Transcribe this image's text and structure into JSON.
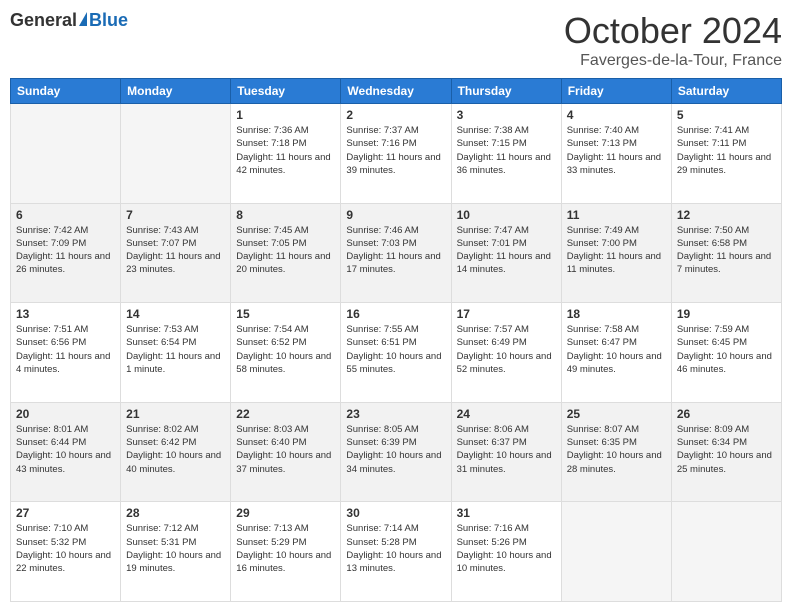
{
  "header": {
    "logo_general": "General",
    "logo_blue": "Blue",
    "month_title": "October 2024",
    "location": "Faverges-de-la-Tour, France"
  },
  "weekdays": [
    "Sunday",
    "Monday",
    "Tuesday",
    "Wednesday",
    "Thursday",
    "Friday",
    "Saturday"
  ],
  "weeks": [
    [
      {
        "day": "",
        "empty": true
      },
      {
        "day": "",
        "empty": true
      },
      {
        "day": "1",
        "sunrise": "7:36 AM",
        "sunset": "7:18 PM",
        "daylight": "11 hours and 42 minutes."
      },
      {
        "day": "2",
        "sunrise": "7:37 AM",
        "sunset": "7:16 PM",
        "daylight": "11 hours and 39 minutes."
      },
      {
        "day": "3",
        "sunrise": "7:38 AM",
        "sunset": "7:15 PM",
        "daylight": "11 hours and 36 minutes."
      },
      {
        "day": "4",
        "sunrise": "7:40 AM",
        "sunset": "7:13 PM",
        "daylight": "11 hours and 33 minutes."
      },
      {
        "day": "5",
        "sunrise": "7:41 AM",
        "sunset": "7:11 PM",
        "daylight": "11 hours and 29 minutes."
      }
    ],
    [
      {
        "day": "6",
        "sunrise": "7:42 AM",
        "sunset": "7:09 PM",
        "daylight": "11 hours and 26 minutes."
      },
      {
        "day": "7",
        "sunrise": "7:43 AM",
        "sunset": "7:07 PM",
        "daylight": "11 hours and 23 minutes."
      },
      {
        "day": "8",
        "sunrise": "7:45 AM",
        "sunset": "7:05 PM",
        "daylight": "11 hours and 20 minutes."
      },
      {
        "day": "9",
        "sunrise": "7:46 AM",
        "sunset": "7:03 PM",
        "daylight": "11 hours and 17 minutes."
      },
      {
        "day": "10",
        "sunrise": "7:47 AM",
        "sunset": "7:01 PM",
        "daylight": "11 hours and 14 minutes."
      },
      {
        "day": "11",
        "sunrise": "7:49 AM",
        "sunset": "7:00 PM",
        "daylight": "11 hours and 11 minutes."
      },
      {
        "day": "12",
        "sunrise": "7:50 AM",
        "sunset": "6:58 PM",
        "daylight": "11 hours and 7 minutes."
      }
    ],
    [
      {
        "day": "13",
        "sunrise": "7:51 AM",
        "sunset": "6:56 PM",
        "daylight": "11 hours and 4 minutes."
      },
      {
        "day": "14",
        "sunrise": "7:53 AM",
        "sunset": "6:54 PM",
        "daylight": "11 hours and 1 minute."
      },
      {
        "day": "15",
        "sunrise": "7:54 AM",
        "sunset": "6:52 PM",
        "daylight": "10 hours and 58 minutes."
      },
      {
        "day": "16",
        "sunrise": "7:55 AM",
        "sunset": "6:51 PM",
        "daylight": "10 hours and 55 minutes."
      },
      {
        "day": "17",
        "sunrise": "7:57 AM",
        "sunset": "6:49 PM",
        "daylight": "10 hours and 52 minutes."
      },
      {
        "day": "18",
        "sunrise": "7:58 AM",
        "sunset": "6:47 PM",
        "daylight": "10 hours and 49 minutes."
      },
      {
        "day": "19",
        "sunrise": "7:59 AM",
        "sunset": "6:45 PM",
        "daylight": "10 hours and 46 minutes."
      }
    ],
    [
      {
        "day": "20",
        "sunrise": "8:01 AM",
        "sunset": "6:44 PM",
        "daylight": "10 hours and 43 minutes."
      },
      {
        "day": "21",
        "sunrise": "8:02 AM",
        "sunset": "6:42 PM",
        "daylight": "10 hours and 40 minutes."
      },
      {
        "day": "22",
        "sunrise": "8:03 AM",
        "sunset": "6:40 PM",
        "daylight": "10 hours and 37 minutes."
      },
      {
        "day": "23",
        "sunrise": "8:05 AM",
        "sunset": "6:39 PM",
        "daylight": "10 hours and 34 minutes."
      },
      {
        "day": "24",
        "sunrise": "8:06 AM",
        "sunset": "6:37 PM",
        "daylight": "10 hours and 31 minutes."
      },
      {
        "day": "25",
        "sunrise": "8:07 AM",
        "sunset": "6:35 PM",
        "daylight": "10 hours and 28 minutes."
      },
      {
        "day": "26",
        "sunrise": "8:09 AM",
        "sunset": "6:34 PM",
        "daylight": "10 hours and 25 minutes."
      }
    ],
    [
      {
        "day": "27",
        "sunrise": "7:10 AM",
        "sunset": "5:32 PM",
        "daylight": "10 hours and 22 minutes."
      },
      {
        "day": "28",
        "sunrise": "7:12 AM",
        "sunset": "5:31 PM",
        "daylight": "10 hours and 19 minutes."
      },
      {
        "day": "29",
        "sunrise": "7:13 AM",
        "sunset": "5:29 PM",
        "daylight": "10 hours and 16 minutes."
      },
      {
        "day": "30",
        "sunrise": "7:14 AM",
        "sunset": "5:28 PM",
        "daylight": "10 hours and 13 minutes."
      },
      {
        "day": "31",
        "sunrise": "7:16 AM",
        "sunset": "5:26 PM",
        "daylight": "10 hours and 10 minutes."
      },
      {
        "day": "",
        "empty": true
      },
      {
        "day": "",
        "empty": true
      }
    ]
  ]
}
